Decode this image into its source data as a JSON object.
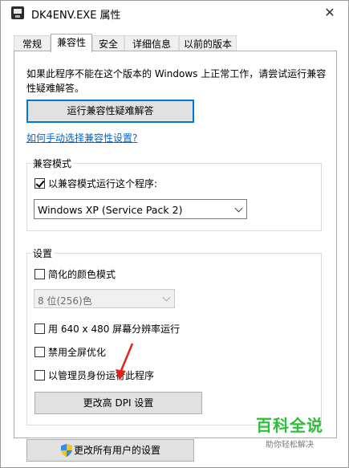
{
  "window": {
    "title": "DK4ENV.EXE 属性",
    "close_glyph": "✕"
  },
  "tabs": [
    {
      "label": "常规",
      "active": false
    },
    {
      "label": "兼容性",
      "active": true
    },
    {
      "label": "安全",
      "active": false
    },
    {
      "label": "详细信息",
      "active": false
    },
    {
      "label": "以前的版本",
      "active": false
    }
  ],
  "compat": {
    "description": "如果此程序不能在这个版本的 Windows 上正常工作，请尝试运行兼容性疑难解答。",
    "troubleshoot_button": "运行兼容性疑难解答",
    "manual_link": "如何手动选择兼容性设置?"
  },
  "compat_mode": {
    "group_label": "兼容模式",
    "checkbox_label": "以兼容模式运行这个程序:",
    "checkbox_checked": true,
    "selected_os": "Windows XP (Service Pack 2)"
  },
  "settings": {
    "group_label": "设置",
    "reduced_color_label": "简化的颜色模式",
    "reduced_color_checked": false,
    "color_select_value": "8 位(256)色",
    "res_640_label": "用 640 x 480 屏幕分辨率运行",
    "res_640_checked": false,
    "disable_fullscreen_label": "禁用全屏优化",
    "disable_fullscreen_checked": false,
    "run_as_admin_label": "以管理员身份运行此程序",
    "run_as_admin_checked": false,
    "dpi_button": "更改高 DPI 设置"
  },
  "all_users_button": "更改所有用户的设置",
  "watermark": {
    "main": "百科全说",
    "sub": "助你轻松解决"
  },
  "colors": {
    "accent": "#0078d7",
    "link": "#0066cc",
    "annotation": "#e0241b",
    "watermark": "#2bbf3a"
  }
}
